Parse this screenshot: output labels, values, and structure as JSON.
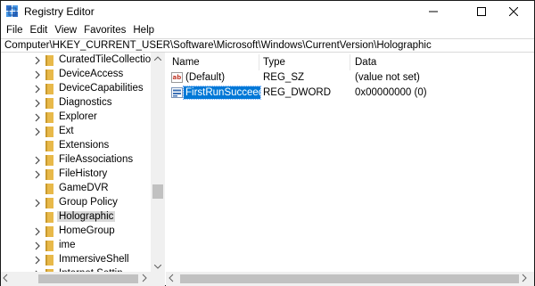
{
  "window": {
    "title": "Registry Editor",
    "controls": {
      "minimize": "minimize",
      "maximize": "maximize",
      "close": "close"
    }
  },
  "menu": [
    "File",
    "Edit",
    "View",
    "Favorites",
    "Help"
  ],
  "address": "Computer\\HKEY_CURRENT_USER\\Software\\Microsoft\\Windows\\CurrentVersion\\Holographic",
  "tree": {
    "items": [
      {
        "label": "CuratedTileCollections",
        "expandable": true,
        "selected": false
      },
      {
        "label": "DeviceAccess",
        "expandable": true,
        "selected": false
      },
      {
        "label": "DeviceCapabilities",
        "expandable": true,
        "selected": false
      },
      {
        "label": "Diagnostics",
        "expandable": true,
        "selected": false
      },
      {
        "label": "Explorer",
        "expandable": true,
        "selected": false
      },
      {
        "label": "Ext",
        "expandable": true,
        "selected": false
      },
      {
        "label": "Extensions",
        "expandable": false,
        "selected": false
      },
      {
        "label": "FileAssociations",
        "expandable": true,
        "selected": false
      },
      {
        "label": "FileHistory",
        "expandable": true,
        "selected": false
      },
      {
        "label": "GameDVR",
        "expandable": false,
        "selected": false
      },
      {
        "label": "Group Policy",
        "expandable": true,
        "selected": false
      },
      {
        "label": "Holographic",
        "expandable": false,
        "selected": true
      },
      {
        "label": "HomeGroup",
        "expandable": true,
        "selected": false
      },
      {
        "label": "ime",
        "expandable": true,
        "selected": false
      },
      {
        "label": "ImmersiveShell",
        "expandable": true,
        "selected": false
      },
      {
        "label": "Internet Settin",
        "expandable": true,
        "selected": false
      }
    ]
  },
  "values": {
    "columns": {
      "name": "Name",
      "type": "Type",
      "data": "Data"
    },
    "rows": [
      {
        "icon": "string-value-icon",
        "name": "(Default)",
        "type": "REG_SZ",
        "data": "(value not set)",
        "selected": false
      },
      {
        "icon": "dword-value-icon",
        "name": "FirstRunSucceed...",
        "type": "REG_DWORD",
        "data": "0x00000000 (0)",
        "selected": true
      }
    ]
  },
  "colors": {
    "selection": "#0078d7",
    "tree_selection": "#d9d9d9",
    "folder": "#e8b94a",
    "string_icon_red": "#c0392b",
    "dword_icon_blue": "#3a6fb5"
  }
}
